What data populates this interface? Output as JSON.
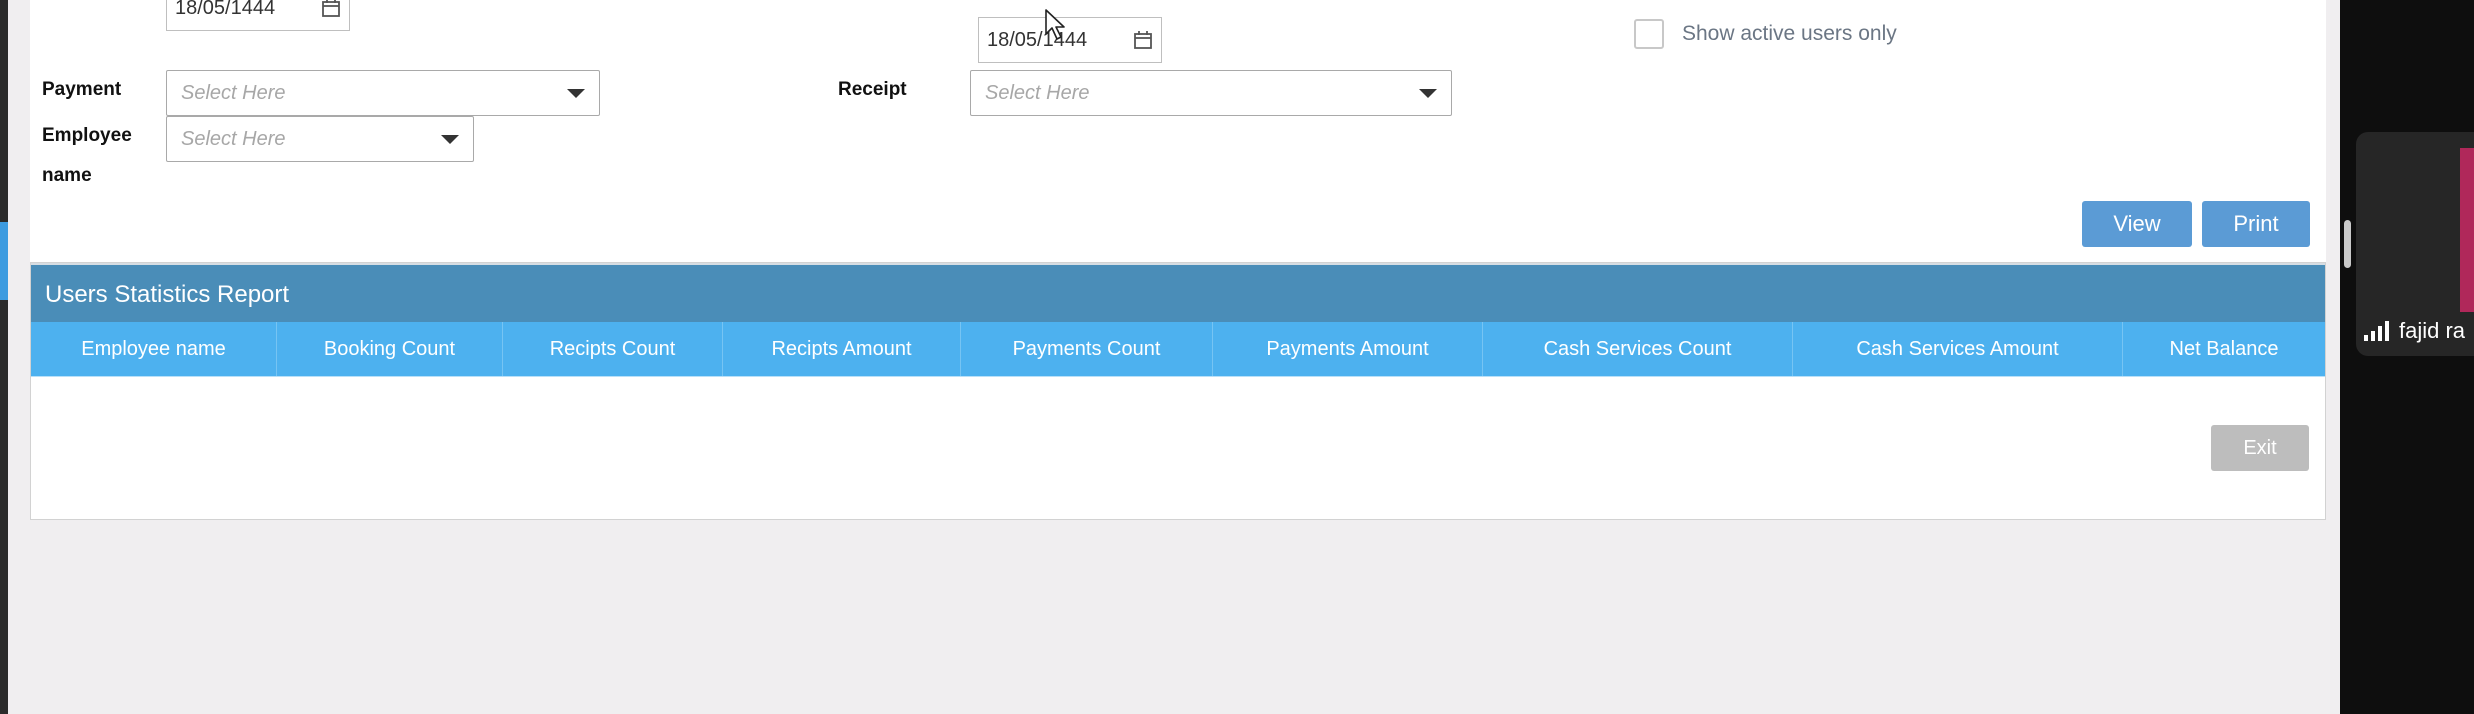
{
  "form": {
    "date_from": "18/05/1444",
    "date_to": "18/05/1444",
    "show_active_label": "Show active users only",
    "payment_label": "Payment",
    "payment_placeholder": "Select Here",
    "receipt_label": "Receipt",
    "receipt_placeholder": "Select Here",
    "employee_label_line1": "Employee",
    "employee_label_line2": "name",
    "employee_placeholder": "Select Here"
  },
  "actions": {
    "view_label": "View",
    "print_label": "Print",
    "exit_label": "Exit"
  },
  "report": {
    "title": "Users Statistics Report",
    "columns": [
      "Employee name",
      "Booking Count",
      "Recipts Count",
      "Recipts Amount",
      "Payments Count",
      "Payments Amount",
      "Cash Services Count",
      "Cash Services Amount",
      "Net Balance"
    ],
    "rows": []
  },
  "participant": {
    "name": "fajid ra"
  },
  "colors": {
    "primary_button": "#5b9bd5",
    "report_title_bg": "#4a8db8",
    "report_header_bg": "#4db1ef",
    "exit_button_bg": "#bdbdbd",
    "participant_accent": "#b0285a"
  },
  "icons": {
    "date_icon": "calendar-icon",
    "select_icon": "chevron-down-icon",
    "signal_icon": "signal-bars-icon"
  }
}
